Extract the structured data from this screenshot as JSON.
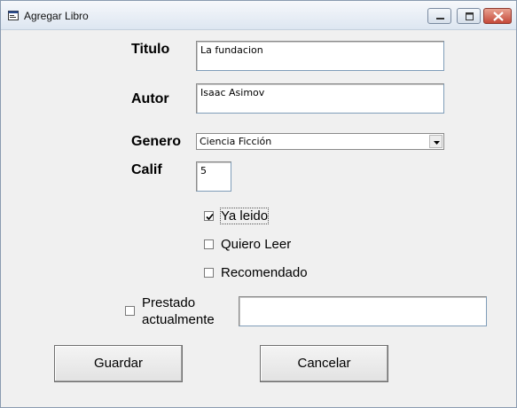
{
  "window": {
    "title": "Agregar Libro",
    "icon": "form-window-icon"
  },
  "form": {
    "titulo_label": "Titulo",
    "titulo_value": "La fundacion",
    "autor_label": "Autor",
    "autor_value": "Isaac Asimov",
    "genero_label": "Genero",
    "genero_value": "Ciencia Ficción",
    "calif_label": "Calif",
    "calif_value": "5"
  },
  "checks": [
    {
      "label": "Ya leido",
      "checked": true
    },
    {
      "label": "Quiero Leer",
      "checked": false
    },
    {
      "label": "Recomendado",
      "checked": false
    }
  ],
  "prestado": {
    "label_line1": "Prestado",
    "label_line2": "actualmente",
    "checked": false,
    "value": ""
  },
  "buttons": {
    "guardar": "Guardar",
    "cancelar": "Cancelar"
  }
}
